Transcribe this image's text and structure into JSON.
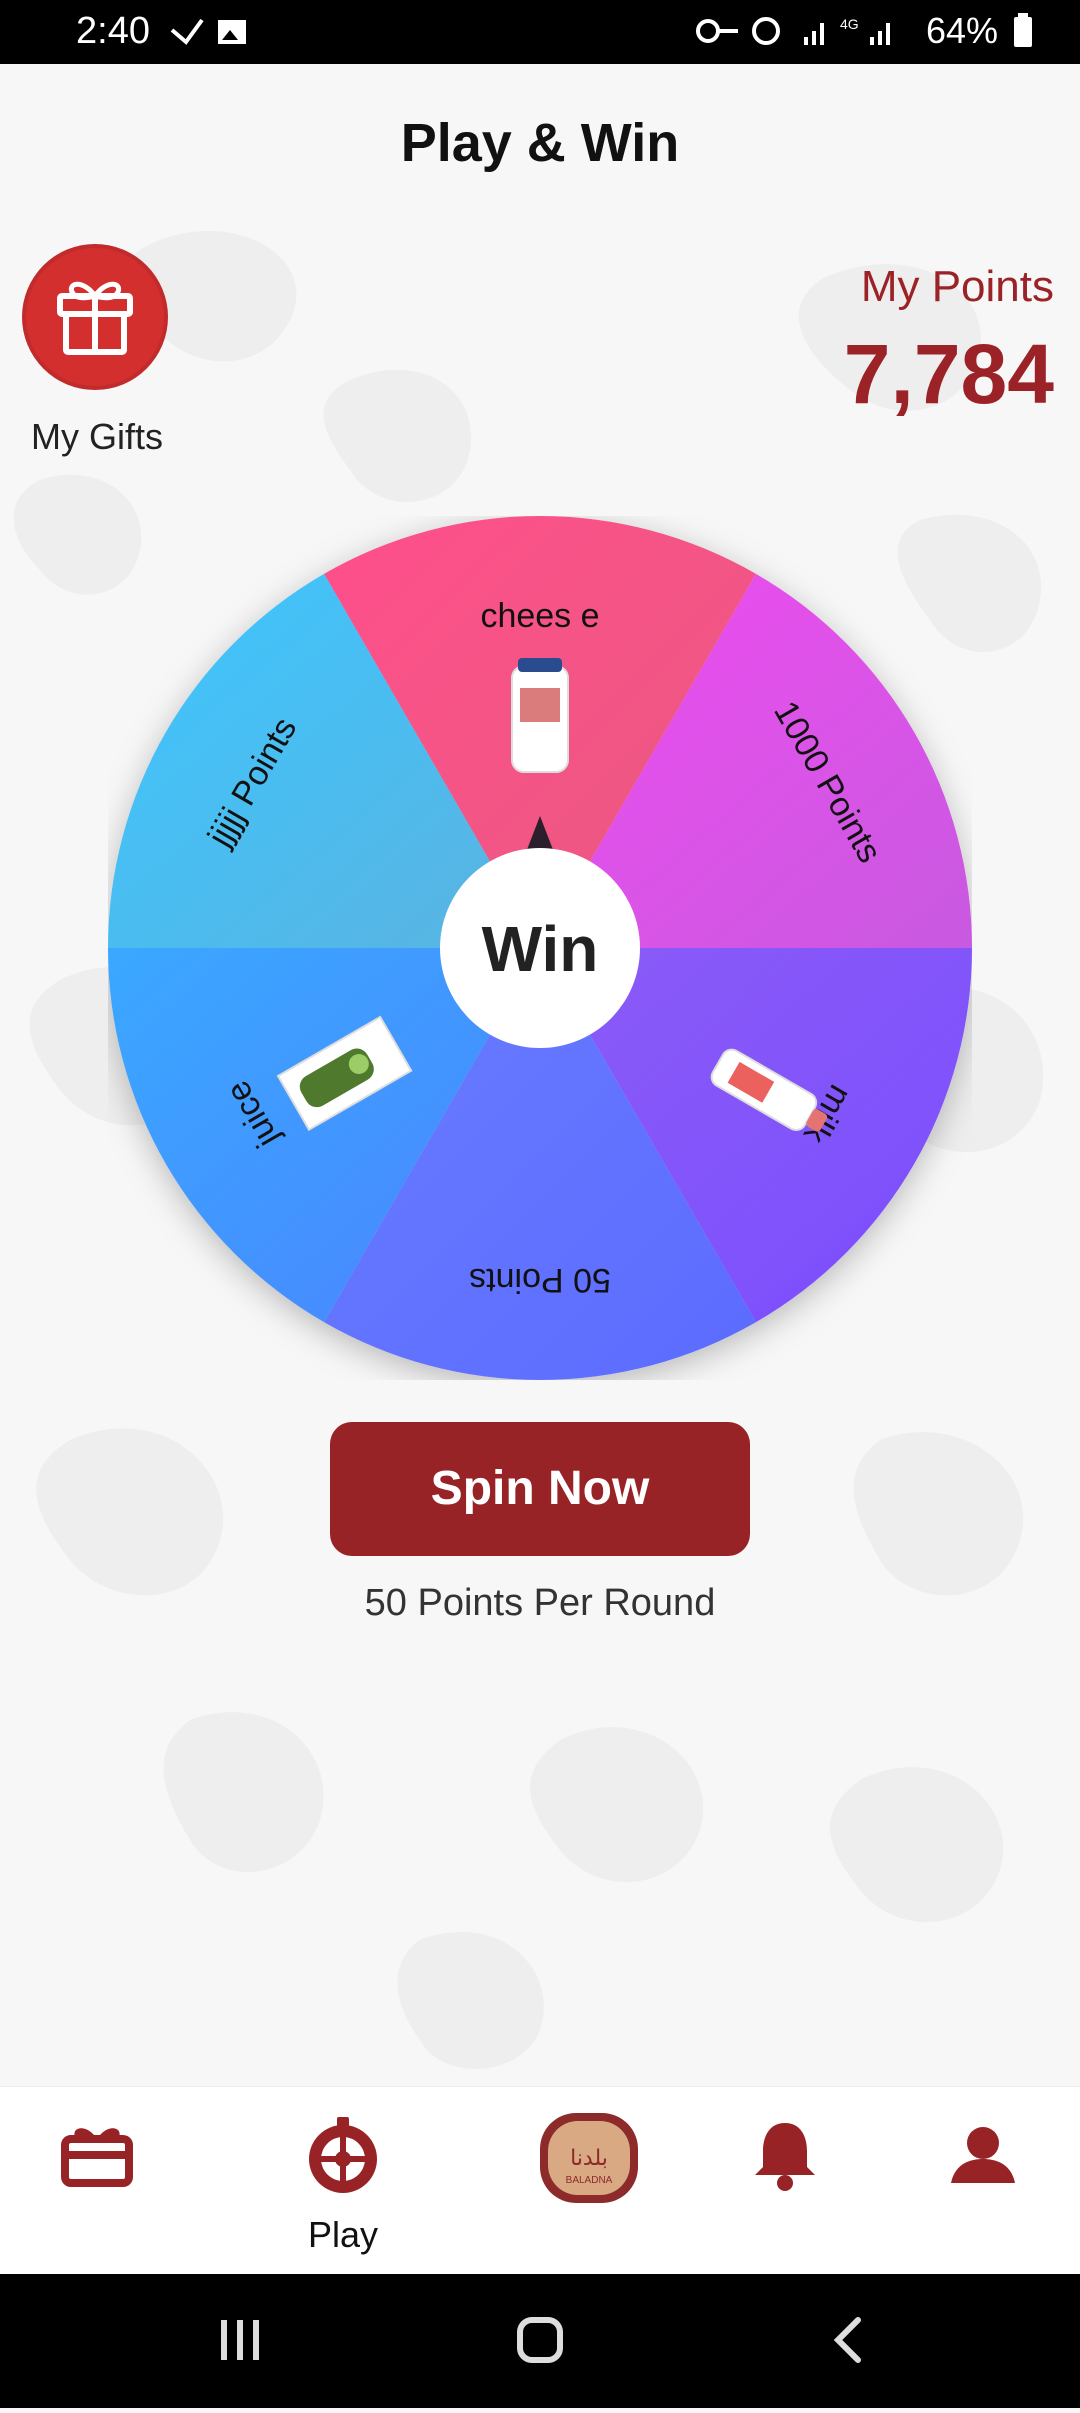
{
  "status_bar": {
    "time": "2:40",
    "battery": "64%",
    "network_4g": "4G"
  },
  "header": {
    "title": "Play & Win"
  },
  "gifts": {
    "label": "My Gifts"
  },
  "points": {
    "label": "My Points",
    "value": "7,784"
  },
  "wheel": {
    "center_label": "Win",
    "segments": [
      {
        "label": "chees e",
        "icon": "mayonnaise-jar-icon",
        "color_start": "#ff4f8b",
        "color_end": "#e85a80"
      },
      {
        "label": "1000 Points",
        "icon": "",
        "color_start": "#f04bf0",
        "color_end": "#c85ae0"
      },
      {
        "label": "milk",
        "icon": "milk-bottle-icon",
        "color_start": "#8b5cf6",
        "color_end": "#7a4dff"
      },
      {
        "label": "50 Points",
        "icon": "",
        "color_start": "#6a7cff",
        "color_end": "#5b6bff"
      },
      {
        "label": "juice",
        "icon": "juice-bottle-icon",
        "color_start": "#3aa8ff",
        "color_end": "#4a84ff"
      },
      {
        "label": "jjjjj Points",
        "icon": "",
        "color_start": "#3cc6ff",
        "color_end": "#5ab3e0"
      }
    ]
  },
  "actions": {
    "spin_label": "Spin Now",
    "per_round": "50 Points Per Round"
  },
  "bottom_nav": {
    "play_label": "Play",
    "logo_text": "BALADNA"
  },
  "colors": {
    "brand": "#972327",
    "brand_light": "#d32f2f"
  }
}
